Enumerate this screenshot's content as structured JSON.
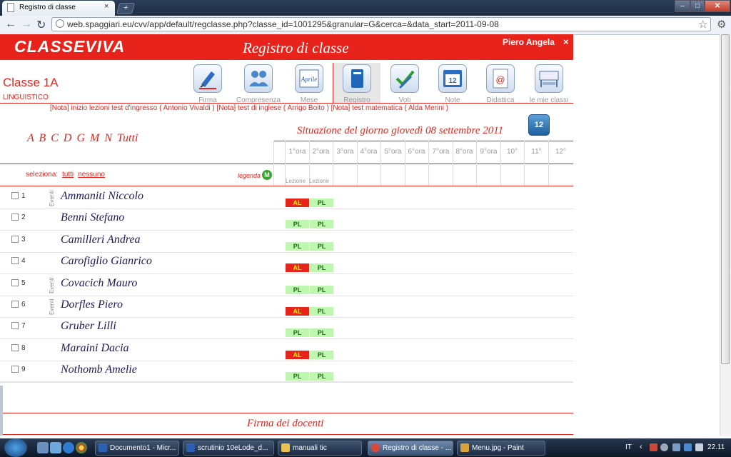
{
  "browser": {
    "tab_title": "Registro di classe",
    "tab_close": "×",
    "new_tab": "+",
    "url": "web.spaggiari.eu/cvv/app/default/regclasse.php?classe_id=1001295&granular=G&cerca=&data_start=2011-09-08",
    "window_buttons": {
      "minimize": "–",
      "maximize": "□",
      "close": "✕"
    }
  },
  "header": {
    "logo": "CLASSEVIVA",
    "title": "Registro di classe",
    "user": "Piero Angela",
    "logout": "×",
    "accent_color": "#e8231b"
  },
  "classe": {
    "name": "Classe 1A",
    "indirizzo": "LINGUISTICO"
  },
  "nav": [
    {
      "label": "Firma",
      "icon": "pen-icon"
    },
    {
      "label": "Compresenza",
      "icon": "people-icon"
    },
    {
      "label": "Mese",
      "icon": "calendar-aprile-icon",
      "icon_text": "Aprile"
    },
    {
      "label": "Registro",
      "icon": "book-icon"
    },
    {
      "label": "Voti",
      "icon": "checkmark-icon"
    },
    {
      "label": "Note",
      "icon": "calendar-note-icon",
      "icon_text": "12"
    },
    {
      "label": "Didattica",
      "icon": "at-document-icon",
      "icon_text": "@"
    },
    {
      "label": "le mie classi",
      "icon": "desk-icon"
    }
  ],
  "note_line": "[Nota] inizio lezioni test d'ingresso ( Antonio Vivaldi ) [Nota] test di inglese ( Arrigo Boito ) [Nota] test matematica ( Alda Merini )",
  "alphabet": "A B C D G M N Tutti",
  "situazione": "Situazione del giorno giovedì 08 settembre 2011",
  "calendar_button": "12",
  "hours": [
    "1°ora",
    "2°ora",
    "3°ora",
    "4°ora",
    "5°ora",
    "6°ora",
    "7°ora",
    "8°ora",
    "9°ora",
    "10°",
    "11°",
    "12°"
  ],
  "lesson_types": [
    "Lezione",
    "Lezione"
  ],
  "seleziona": {
    "label": "seleziona:",
    "all": "tutti",
    "none": "nessuno"
  },
  "legenda": {
    "label": "legenda",
    "icon_letter": "M"
  },
  "students": [
    {
      "n": "1",
      "name": "Ammaniti Niccolo",
      "eventi": "Eventi",
      "h1": "AL",
      "h2": "PL"
    },
    {
      "n": "2",
      "name": "Benni Stefano",
      "eventi": "",
      "h1": "PL",
      "h2": "PL"
    },
    {
      "n": "3",
      "name": "Camilleri Andrea",
      "eventi": "",
      "h1": "PL",
      "h2": "PL"
    },
    {
      "n": "4",
      "name": "Carofiglio Gianrico",
      "eventi": "",
      "h1": "AL",
      "h2": "PL"
    },
    {
      "n": "5",
      "name": "Covacich Mauro",
      "eventi": "Eventi",
      "h1": "PL",
      "h2": "PL"
    },
    {
      "n": "6",
      "name": "Dorfles Piero",
      "eventi": "Eventi",
      "h1": "AL",
      "h2": "PL"
    },
    {
      "n": "7",
      "name": "Gruber Lilli",
      "eventi": "",
      "h1": "PL",
      "h2": "PL"
    },
    {
      "n": "8",
      "name": "Maraini Dacia",
      "eventi": "",
      "h1": "AL",
      "h2": "PL"
    },
    {
      "n": "9",
      "name": "Nothomb Amelie",
      "eventi": "",
      "h1": "PL",
      "h2": "PL"
    }
  ],
  "firma_title": "Firma dei docenti",
  "taskbar": {
    "tasks": [
      {
        "label": "Documento1 - Micr...",
        "color": "#2b5fb4"
      },
      {
        "label": "scrutinio 10eLode_d...",
        "color": "#2b5fb4"
      },
      {
        "label": "manuali tic",
        "color": "#e8c24a"
      },
      {
        "label": "Registro di classe - ...",
        "color": "#d94a3a"
      },
      {
        "label": "Menu.jpg - Paint",
        "color": "#d9a23a"
      }
    ],
    "lang": "IT",
    "tray_arrow": "‹",
    "clock": "22.11"
  }
}
